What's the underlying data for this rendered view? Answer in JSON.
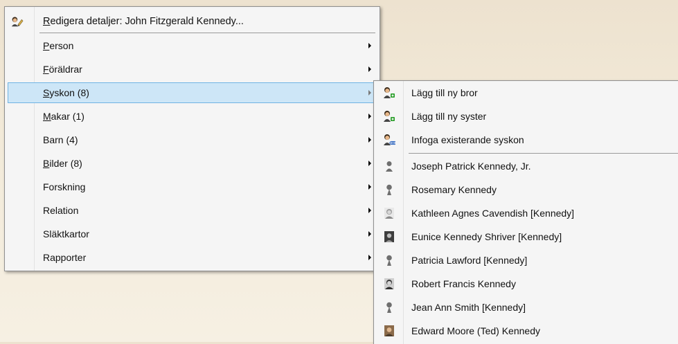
{
  "main_menu": {
    "header": {
      "mnemonic": "R",
      "rest": "edigera detaljer: John Fitzgerald Kennedy...",
      "icon": "edit-person-icon"
    },
    "items": [
      {
        "mnemonic": "P",
        "rest": "erson"
      },
      {
        "mnemonic": "F",
        "rest": "öräldrar"
      },
      {
        "mnemonic": "S",
        "rest": "yskon (8)"
      },
      {
        "mnemonic": "M",
        "rest": "akar (1)"
      },
      {
        "mnemonic": "",
        "rest": "Barn (4)"
      },
      {
        "mnemonic": "B",
        "rest": "ilder (8)"
      },
      {
        "mnemonic": "",
        "rest": "Forskning"
      },
      {
        "mnemonic": "",
        "rest": "Relation"
      },
      {
        "mnemonic": "",
        "rest": "Släktkartor"
      },
      {
        "mnemonic": "",
        "rest": "Rapporter"
      }
    ]
  },
  "sub_menu": {
    "actions": [
      {
        "label": "Lägg till ny bror",
        "icon": "add-brother-icon"
      },
      {
        "label": "Lägg till ny syster",
        "icon": "add-sister-icon"
      },
      {
        "label": "Infoga existerande syskon",
        "icon": "link-sibling-icon"
      }
    ],
    "siblings": [
      {
        "label": "Joseph Patrick Kennedy, Jr.",
        "icon": "male-silhouette-icon"
      },
      {
        "label": "Rosemary Kennedy",
        "icon": "female-silhouette-icon"
      },
      {
        "label": "Kathleen Agnes Cavendish [Kennedy]",
        "icon": "photo-icon"
      },
      {
        "label": "Eunice Kennedy Shriver [Kennedy]",
        "icon": "photo-icon"
      },
      {
        "label": "Patricia Lawford [Kennedy]",
        "icon": "female-silhouette-icon"
      },
      {
        "label": "Robert Francis Kennedy",
        "icon": "photo-icon"
      },
      {
        "label": "Jean Ann Smith [Kennedy]",
        "icon": "female-silhouette-icon"
      },
      {
        "label": "Edward Moore (Ted) Kennedy",
        "icon": "photo-icon"
      }
    ]
  }
}
